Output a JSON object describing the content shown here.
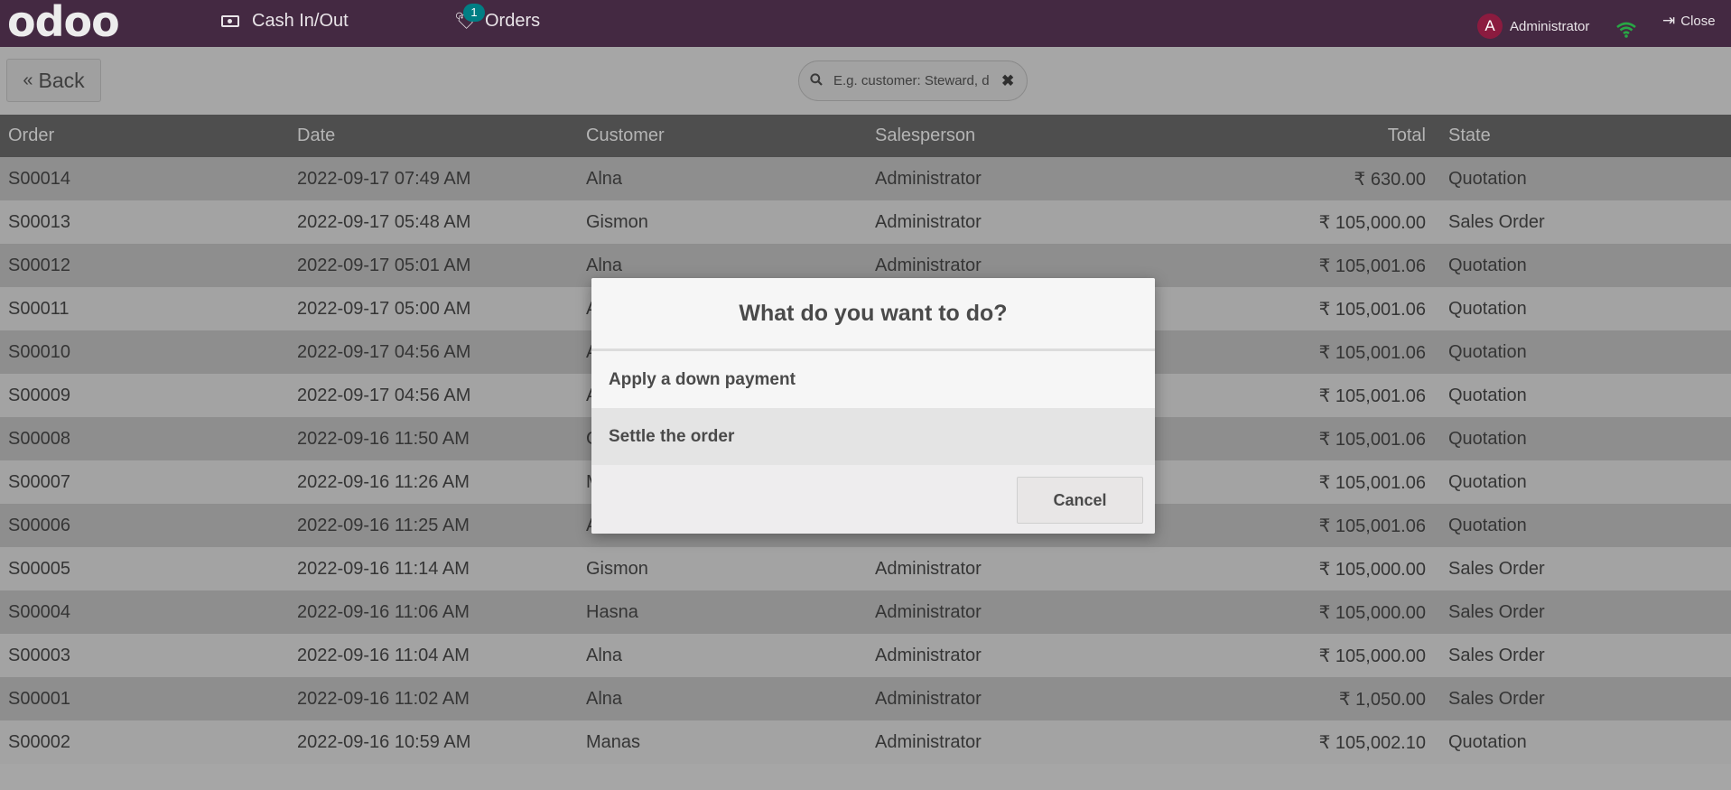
{
  "navbar": {
    "logo": "odoo",
    "cash_label": "Cash In/Out",
    "orders_label": "Orders",
    "orders_badge": "1",
    "user_initial": "A",
    "user_name": "Administrator",
    "close_label": "Close"
  },
  "controls": {
    "back_label": "Back",
    "search_placeholder": "E.g. customer: Steward, d"
  },
  "table": {
    "headers": [
      "Order",
      "Date",
      "Customer",
      "Salesperson",
      "Total",
      "State"
    ],
    "rows": [
      [
        "S00014",
        "2022-09-17 07:49 AM",
        "Alna",
        "Administrator",
        "₹ 630.00",
        "Quotation"
      ],
      [
        "S00013",
        "2022-09-17 05:48 AM",
        "Gismon",
        "Administrator",
        "₹ 105,000.00",
        "Sales Order"
      ],
      [
        "S00012",
        "2022-09-17 05:01 AM",
        "Alna",
        "Administrator",
        "₹ 105,001.06",
        "Quotation"
      ],
      [
        "S00011",
        "2022-09-17 05:00 AM",
        "A",
        "",
        "₹ 105,001.06",
        "Quotation"
      ],
      [
        "S00010",
        "2022-09-17 04:56 AM",
        "A",
        "",
        "₹ 105,001.06",
        "Quotation"
      ],
      [
        "S00009",
        "2022-09-17 04:56 AM",
        "A",
        "",
        "₹ 105,001.06",
        "Quotation"
      ],
      [
        "S00008",
        "2022-09-16 11:50 AM",
        "G",
        "",
        "₹ 105,001.06",
        "Quotation"
      ],
      [
        "S00007",
        "2022-09-16 11:26 AM",
        "M",
        "",
        "₹ 105,001.06",
        "Quotation"
      ],
      [
        "S00006",
        "2022-09-16 11:25 AM",
        "A",
        "",
        "₹ 105,001.06",
        "Quotation"
      ],
      [
        "S00005",
        "2022-09-16 11:14 AM",
        "Gismon",
        "Administrator",
        "₹ 105,000.00",
        "Sales Order"
      ],
      [
        "S00004",
        "2022-09-16 11:06 AM",
        "Hasna",
        "Administrator",
        "₹ 105,000.00",
        "Sales Order"
      ],
      [
        "S00003",
        "2022-09-16 11:04 AM",
        "Alna",
        "Administrator",
        "₹ 105,000.00",
        "Sales Order"
      ],
      [
        "S00001",
        "2022-09-16 11:02 AM",
        "Alna",
        "Administrator",
        "₹ 1,050.00",
        "Sales Order"
      ],
      [
        "S00002",
        "2022-09-16 10:59 AM",
        "Manas",
        "Administrator",
        "₹ 105,002.10",
        "Quotation"
      ]
    ]
  },
  "modal": {
    "title": "What do you want to do?",
    "option_1": "Apply a down payment",
    "option_2": "Settle the order",
    "cancel_label": "Cancel"
  },
  "colors": {
    "navbar": "#442942",
    "badge": "#017e84",
    "avatar": "#8b1b3f",
    "wifi": "#28a745"
  }
}
